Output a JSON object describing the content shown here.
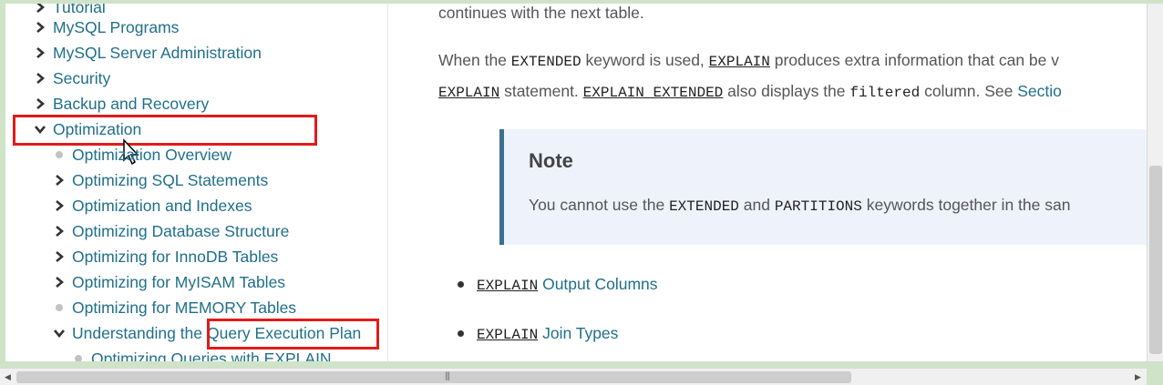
{
  "sidebar": {
    "items": [
      {
        "label": "Tutorial",
        "icon": "chevron-right-icon"
      },
      {
        "label": "MySQL Programs",
        "icon": "chevron-right-icon"
      },
      {
        "label": "MySQL Server Administration",
        "icon": "chevron-right-icon"
      },
      {
        "label": "Security",
        "icon": "chevron-right-icon"
      },
      {
        "label": "Backup and Recovery",
        "icon": "chevron-right-icon"
      },
      {
        "label": "Optimization",
        "icon": "chevron-down-icon"
      }
    ],
    "sub_items": [
      {
        "label": "Optimization Overview",
        "icon": "bullet-icon"
      },
      {
        "label": "Optimizing SQL Statements",
        "icon": "chevron-right-icon"
      },
      {
        "label": "Optimization and Indexes",
        "icon": "chevron-right-icon"
      },
      {
        "label": "Optimizing Database Structure",
        "icon": "chevron-right-icon"
      },
      {
        "label": "Optimizing for InnoDB Tables",
        "icon": "chevron-right-icon"
      },
      {
        "label": "Optimizing for MyISAM Tables",
        "icon": "chevron-right-icon"
      },
      {
        "label": "Optimizing for MEMORY Tables",
        "icon": "bullet-icon"
      }
    ],
    "understanding": {
      "prefix": "Understanding the ",
      "link": "Query Execution Plan",
      "icon": "chevron-down-icon"
    },
    "nested": {
      "label": "Optimizing Queries with EXPLAIN",
      "icon": "bullet-icon"
    }
  },
  "content": {
    "line0": "continues with the next table.",
    "p1": {
      "a": "When the ",
      "b": "EXTENDED",
      "c": " keyword is used, ",
      "d": "EXPLAIN",
      "e": " produces extra information that can be v"
    },
    "p2": {
      "a": "EXPLAIN",
      "b": " statement. ",
      "c": "EXPLAIN EXTENDED",
      "d": " also displays the ",
      "e": "filtered",
      "f": " column. See ",
      "g": "Sectio"
    },
    "note": {
      "title": "Note",
      "a": "You cannot use the ",
      "b": "EXTENDED",
      "c": " and ",
      "d": "PARTITIONS",
      "e": " keywords together in the san"
    },
    "bullets": [
      {
        "code": "EXPLAIN",
        "text": " Output Columns"
      },
      {
        "code": "EXPLAIN",
        "text": " Join Types"
      }
    ]
  },
  "colors": {
    "link": "#1f6f8b",
    "highlight": "#e21b1b",
    "note_bg": "#eef3fb",
    "note_bar": "#3a6f8e",
    "frame_bg": "#cfe3c8"
  }
}
